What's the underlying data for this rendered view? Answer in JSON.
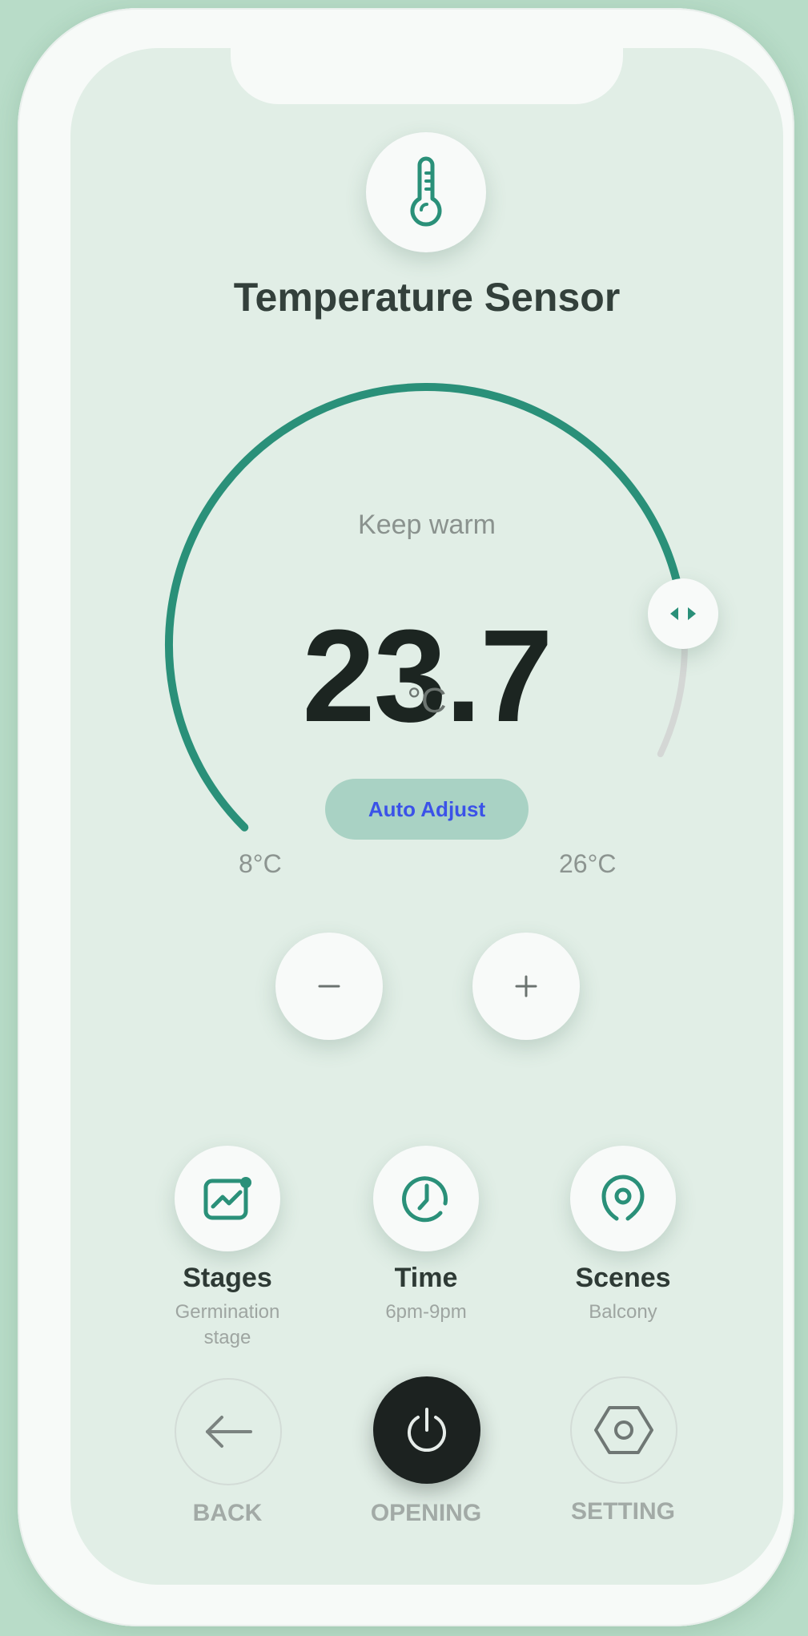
{
  "header": {
    "title": "Temperature Sensor",
    "icon": "thermometer-icon"
  },
  "thermostat": {
    "mode": "Keep warm",
    "current_value": "23.7",
    "unit": "°C",
    "min_label": "8°C",
    "max_label": "26°C",
    "min": 8,
    "max": 26,
    "value": 23.7,
    "auto_adjust_label": "Auto Adjust",
    "handle_icon": "left-right-arrows-icon",
    "active_color": "#2a9079",
    "track_color": "#d4d7d5"
  },
  "stepper": {
    "decrease_icon": "minus-icon",
    "increase_icon": "plus-icon"
  },
  "features": [
    {
      "title": "Stages",
      "subtitle": "Germination stage",
      "icon": "chart-icon"
    },
    {
      "title": "Time",
      "subtitle": "6pm-9pm",
      "icon": "clock-icon"
    },
    {
      "title": "Scenes",
      "subtitle": "Balcony",
      "icon": "location-pin-icon"
    }
  ],
  "nav": {
    "back_label": "BACK",
    "opening_label": "OPENING",
    "setting_label": "SETTING"
  },
  "colors": {
    "accent": "#2a9079",
    "screen_bg": "#e1eee6",
    "power_bg": "#1c2220"
  }
}
